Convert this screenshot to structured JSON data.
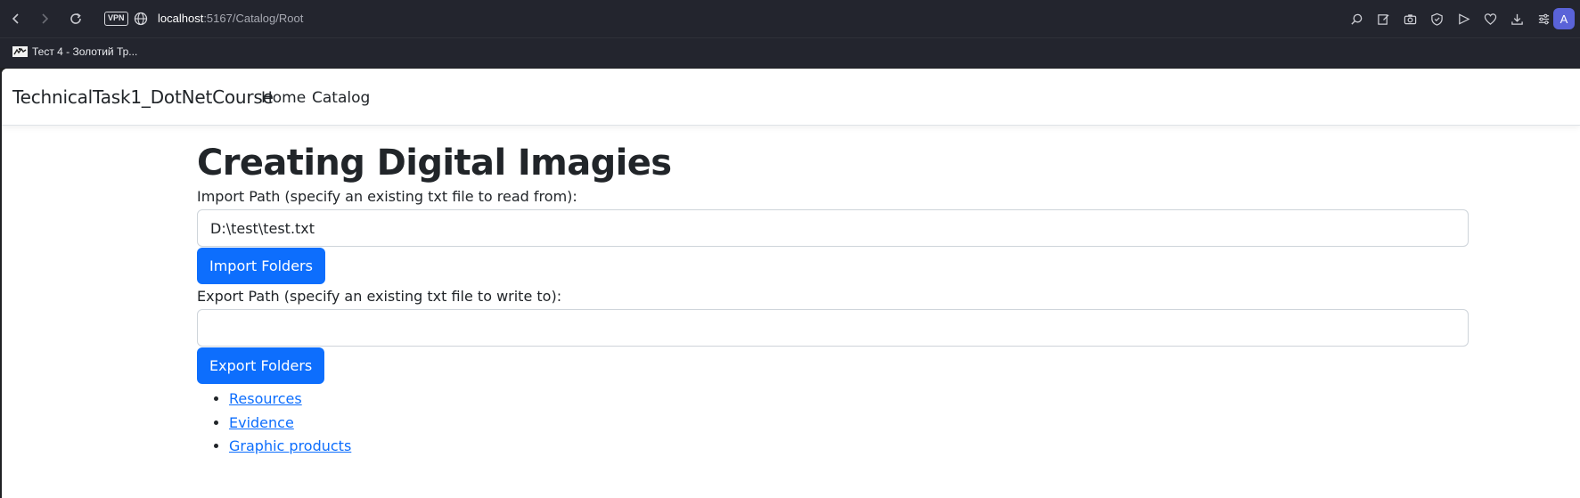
{
  "browser": {
    "url_host": "localhost",
    "url_path": ":5167/Catalog/Root",
    "vpn_label": "VPN",
    "profile_initial": "A",
    "bookmark_label": "Тест 4 - Золотий Тр..."
  },
  "navbar": {
    "brand": "TechnicalTask1_DotNetCourse",
    "links": [
      "Home",
      "Catalog"
    ]
  },
  "page": {
    "title": "Creating Digital Imagies",
    "import_label": "Import Path (specify an existing txt file to read from):",
    "import_value": "D:\\test\\test.txt",
    "import_button": "Import Folders",
    "export_label": "Export Path (specify an existing txt file to write to):",
    "export_value": "",
    "export_button": "Export Folders",
    "folders": [
      "Resources",
      "Evidence",
      "Graphic products"
    ]
  },
  "colors": {
    "primary": "#0d6efd",
    "text": "#212529",
    "chrome_bg": "#23252e"
  }
}
